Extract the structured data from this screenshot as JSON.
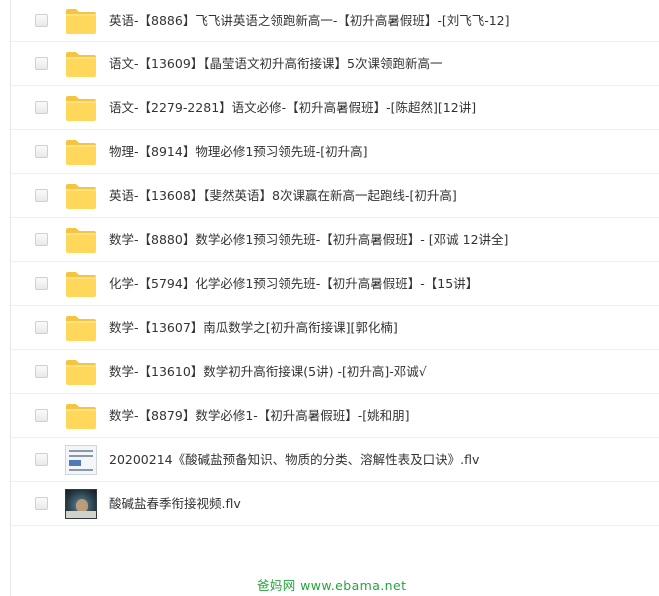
{
  "files": [
    {
      "type": "folder",
      "name": "英语-【8886】飞飞讲英语之领跑新高一-【初升高暑假班】-[刘飞飞-12]"
    },
    {
      "type": "folder",
      "name": "语文-【13609】【晶莹语文初升高衔接课】5次课领跑新高一"
    },
    {
      "type": "folder",
      "name": "语文-【2279-2281】语文必修-【初升高暑假班】-[陈超然][12讲]"
    },
    {
      "type": "folder",
      "name": "物理-【8914】物理必修1预习领先班-[初升高]"
    },
    {
      "type": "folder",
      "name": "英语-【13608】【斐然英语】8次课赢在新高一起跑线-[初升高]"
    },
    {
      "type": "folder",
      "name": "数学-【8880】数学必修1预习领先班-【初升高暑假班】- [邓诚 12讲全]"
    },
    {
      "type": "folder",
      "name": "化学-【5794】化学必修1预习领先班-【初升高暑假班】-【15讲】"
    },
    {
      "type": "folder",
      "name": "数学-【13607】南瓜数学之[初升高衔接课][郭化楠]"
    },
    {
      "type": "folder",
      "name": "数学-【13610】数学初升高衔接课(5讲)  -[初升高]-邓诚√"
    },
    {
      "type": "folder",
      "name": "数学-【8879】数学必修1-【初升高暑假班】-[姚和朋]"
    },
    {
      "type": "video-doc",
      "name": "20200214《酸碱盐预备知识、物质的分类、溶解性表及口诀》.flv"
    },
    {
      "type": "video",
      "name": "酸碱盐春季衔接视频.flv"
    }
  ],
  "watermark": "爸妈网 www.ebama.net",
  "colors": {
    "folder_body": "#ffd75a",
    "folder_tab": "#f5c542",
    "text": "#333333",
    "watermark": "#22a63a"
  }
}
